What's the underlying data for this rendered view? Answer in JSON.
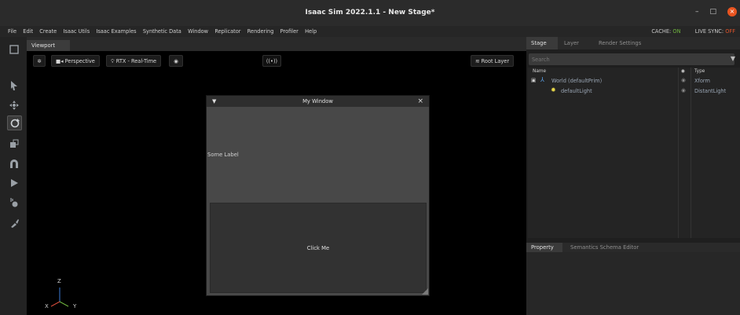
{
  "window": {
    "title": "Isaac Sim 2022.1.1 - New Stage*",
    "controls": [
      "–",
      "□",
      "×"
    ]
  },
  "menu": {
    "items": [
      "File",
      "Edit",
      "Create",
      "Isaac Utils",
      "Isaac Examples",
      "Synthetic Data",
      "Window",
      "Replicator",
      "Rendering",
      "Profiler",
      "Help"
    ],
    "cache_label": "CACHE:",
    "cache_value": "ON",
    "live_sync_label": "LIVE SYNC:",
    "live_sync_value": "OFF"
  },
  "viewport": {
    "tab": "Viewport",
    "camera": "Perspective",
    "renderer": "RTX - Real-Time",
    "layer": "Root Layer",
    "broadcast_icon": "((•))"
  },
  "my_window": {
    "title": "My Window",
    "label": "Some Label",
    "button": "Click Me"
  },
  "gizmo": {
    "z": "Z",
    "x": "X",
    "y": "Y"
  },
  "stage": {
    "tabs": [
      "Stage",
      "Layer",
      "Render Settings"
    ],
    "search_placeholder": "Search",
    "headers": {
      "name": "Name",
      "type": "Type"
    },
    "rows": [
      {
        "name": "World (defaultPrim)",
        "type": "Xform"
      },
      {
        "name": "defaultLight",
        "type": "DistantLight"
      }
    ]
  },
  "property": {
    "tabs": [
      "Property",
      "Semantics Schema Editor"
    ]
  },
  "colors": {
    "on": "#6fb43f",
    "off": "#e0542a",
    "close": "#e95420",
    "light": "#e8d84a"
  }
}
